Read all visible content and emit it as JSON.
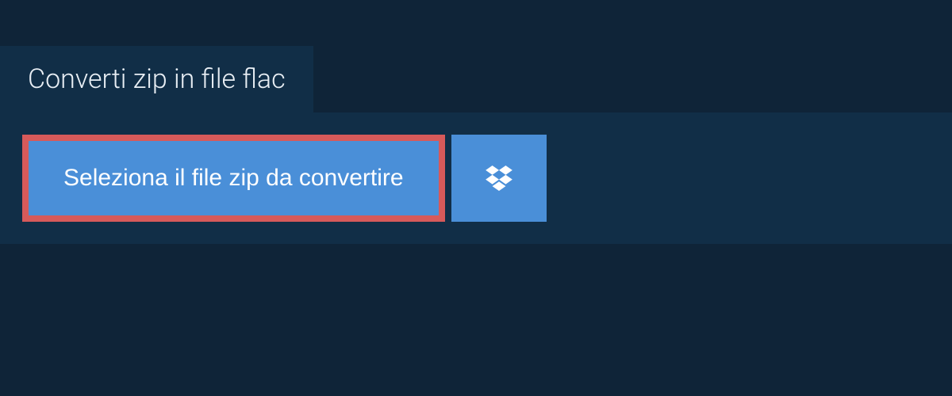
{
  "tab": {
    "label": "Converti zip in file flac"
  },
  "actions": {
    "select_file_label": "Seleziona il file zip da convertire"
  }
}
